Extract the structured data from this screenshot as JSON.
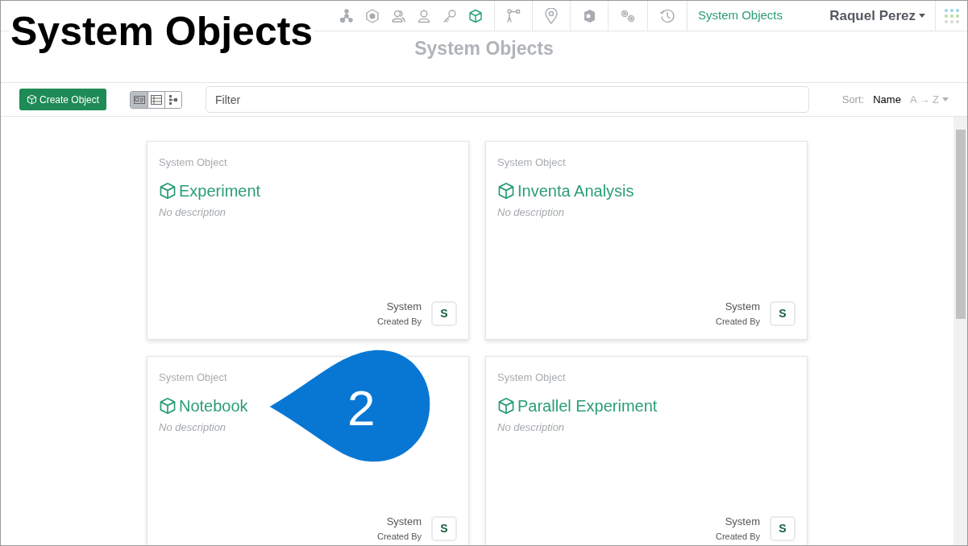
{
  "overlay_title": "System Objects",
  "nav": {
    "icon_groups": [
      [
        {
          "kind": "network",
          "selected": false
        },
        {
          "kind": "badge",
          "selected": false
        },
        {
          "kind": "users",
          "selected": false
        },
        {
          "kind": "user",
          "selected": false
        },
        {
          "kind": "key",
          "selected": false
        },
        {
          "kind": "cube",
          "selected": true
        }
      ],
      [
        {
          "kind": "branch",
          "selected": false
        }
      ],
      [
        {
          "kind": "pin",
          "selected": false
        }
      ],
      [
        {
          "kind": "shield",
          "selected": false
        }
      ],
      [
        {
          "kind": "gears",
          "selected": false
        }
      ],
      [
        {
          "kind": "history",
          "selected": false
        }
      ]
    ],
    "link": "System Objects",
    "user": "Raquel Perez"
  },
  "page_title": "System Objects",
  "toolbar": {
    "create_button": "Create Object",
    "views": [
      {
        "kind": "card",
        "selected": true
      },
      {
        "kind": "table",
        "selected": false
      },
      {
        "kind": "tree",
        "selected": false
      }
    ],
    "filter": {
      "placeholder": "Filter"
    },
    "sort_label": "Sort:",
    "sort_field": "Name",
    "sort_order": "A → Z"
  },
  "cards": [
    {
      "type_label": "System Object",
      "title": "Experiment",
      "description": "No description",
      "creator": "System",
      "creator_label": "Created By",
      "avatar": "S"
    },
    {
      "type_label": "System Object",
      "title": "Inventa Analysis",
      "description": "No description",
      "creator": "System",
      "creator_label": "Created By",
      "avatar": "S"
    },
    {
      "type_label": "System Object",
      "title": "Notebook",
      "description": "No description",
      "creator": "System",
      "creator_label": "Created By",
      "avatar": "S"
    },
    {
      "type_label": "System Object",
      "title": "Parallel Experiment",
      "description": "No description",
      "creator": "System",
      "creator_label": "Created By",
      "avatar": "S"
    }
  ],
  "callout": {
    "number": "2"
  }
}
